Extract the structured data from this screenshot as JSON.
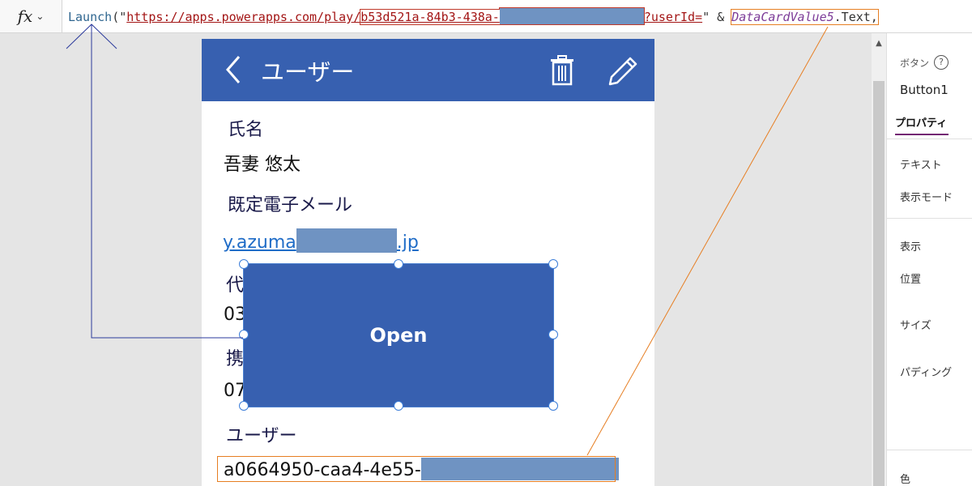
{
  "formula_bar": {
    "fx_label": "fx",
    "formula": {
      "function": "Launch",
      "open": "(\"",
      "url_prefix": "https://apps.powerapps.com/play/",
      "app_id_visible": "b53d521a-84b3-438a-",
      "query": "?userId=",
      "close_quote": "\"",
      "operator": " & ",
      "variable": "DataCardValue5",
      "suffix": ".Text,"
    }
  },
  "app": {
    "title": "ユーザー",
    "fields": [
      {
        "label": "氏名",
        "value": "吾妻 悠太"
      },
      {
        "label": "既定電子メール",
        "value_prefix": "y.azuma",
        "value_suffix": ".jp"
      },
      {
        "label": "代",
        "value": "03"
      },
      {
        "label": "携",
        "value": "07"
      },
      {
        "label": "ユーザー",
        "value_prefix": "a0664950-caa4-4e55-"
      }
    ],
    "button_label": "Open"
  },
  "right_panel": {
    "control_type": "ボタン",
    "control_name": "Button1",
    "tab_properties": "プロパティ",
    "props": [
      "テキスト",
      "表示モード",
      "表示",
      "位置",
      "サイズ",
      "パディング",
      "色"
    ]
  },
  "colors": {
    "header": "#3760b0",
    "button": "#3760b0",
    "redaction": "#6f93c2",
    "highlight_red": "#c0392b",
    "highlight_orange": "#e67e22",
    "annotation_blue": "#2b3a9c"
  }
}
